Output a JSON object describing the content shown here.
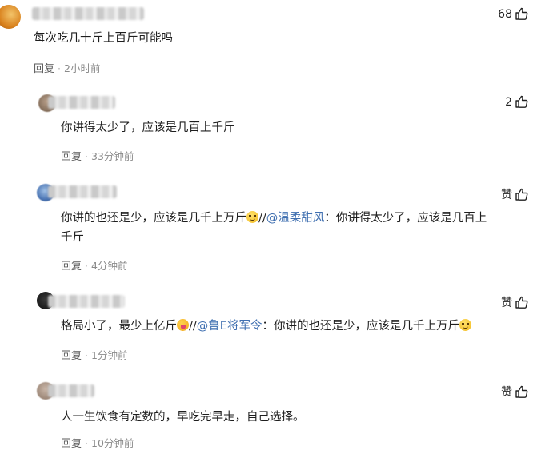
{
  "comments": [
    {
      "likes": "68",
      "text": "每次吃几十斤上百斤可能吗",
      "reply_label": "回复",
      "time": "2小时前"
    },
    {
      "likes": "2",
      "text": "你讲得太少了，应该是几百上千斤",
      "reply_label": "回复",
      "time": "33分钟前"
    },
    {
      "likes": "赞",
      "text_a": "你讲的也还是少，应该是几千上万斤",
      "mention_sep": "//",
      "mention": "@温柔甜风",
      "text_b": "：你讲得太少了，应该是几百上",
      "text_c": "千斤",
      "emoji": "smirk-emoji",
      "reply_label": "回复",
      "time": "4分钟前"
    },
    {
      "likes": "赞",
      "text_a": "格局小了，最少上亿斤",
      "mention_sep": "//",
      "mention": "@鲁E将军令",
      "text_b": "：你讲的也还是少，应该是几千上万斤",
      "emoji_a": "tongue-emoji",
      "emoji_b": "smirk-emoji",
      "reply_label": "回复",
      "time": "1分钟前"
    },
    {
      "likes": "赞",
      "text": "人一生饮食有定数的，早吃完早走，自己选择。",
      "reply_label": "回复",
      "time": "10分钟前"
    }
  ]
}
